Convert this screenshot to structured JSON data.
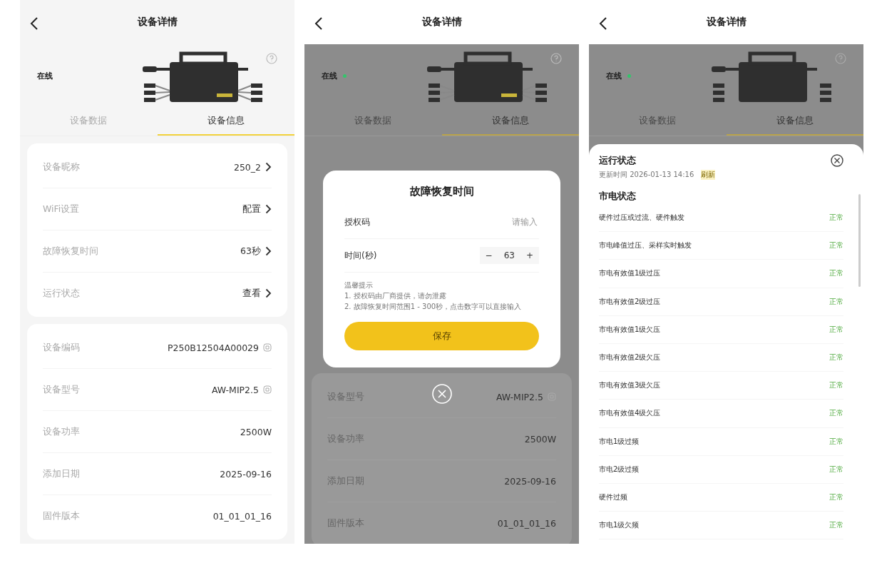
{
  "screens": [
    {
      "title": "设备详情",
      "status": "在线",
      "online_dot": false,
      "dimmed": false,
      "tabs": [
        {
          "label": "设备数据",
          "selected": false
        },
        {
          "label": "设备信息",
          "selected": true
        }
      ],
      "cards": [
        {
          "rows": [
            {
              "label": "设备昵称",
              "value": "250_2",
              "kind": "link"
            },
            {
              "label": "WiFi设置",
              "value": "配置",
              "kind": "link"
            },
            {
              "label": "故障恢复时间",
              "value": "63秒",
              "kind": "link"
            },
            {
              "label": "运行状态",
              "value": "查看",
              "kind": "link"
            }
          ]
        },
        {
          "rows": [
            {
              "label": "设备编码",
              "value": "P250B12504A00029",
              "kind": "copy"
            },
            {
              "label": "设备型号",
              "value": "AW-MIP2.5",
              "kind": "copy"
            },
            {
              "label": "设备功率",
              "value": "2500W",
              "kind": "plain"
            },
            {
              "label": "添加日期",
              "value": "2025-09-16",
              "kind": "plain"
            },
            {
              "label": "固件版本",
              "value": "01_01_01_16",
              "kind": "plain"
            }
          ]
        }
      ]
    },
    {
      "title": "设备详情",
      "status": "在线",
      "online_dot": true,
      "dimmed": true,
      "tabs": [
        {
          "label": "设备数据",
          "selected": false
        },
        {
          "label": "设备信息",
          "selected": true
        }
      ],
      "modal": {
        "title": "故障恢复时间",
        "fields": [
          {
            "label": "授权码",
            "kind": "input",
            "placeholder": "请输入"
          },
          {
            "label": "时间(秒)",
            "kind": "stepper",
            "minus": "−",
            "value": "63",
            "plus": "+"
          }
        ],
        "hint_title": "温馨提示",
        "hints": [
          "1. 授权码由厂商提供，请勿泄露",
          "2. 故障恢复时间范围1 - 300秒，点击数字可以直接输入"
        ],
        "button": "保存"
      },
      "cards": [
        {
          "rows": [
            {
              "label": "设备型号",
              "value": "AW-MIP2.5",
              "kind": "copy"
            },
            {
              "label": "设备功率",
              "value": "2500W",
              "kind": "plain"
            },
            {
              "label": "添加日期",
              "value": "2025-09-16",
              "kind": "plain"
            },
            {
              "label": "固件版本",
              "value": "01_01_01_16",
              "kind": "plain"
            }
          ]
        }
      ]
    },
    {
      "title": "设备详情",
      "status": "在线",
      "online_dot": true,
      "dimmed": true,
      "tabs": [
        {
          "label": "设备数据",
          "selected": false
        },
        {
          "label": "设备信息",
          "selected": true
        }
      ],
      "sheet": {
        "title": "运行状态",
        "updated": "更新时间 2026-01-13 14:16",
        "refresh": "刷新",
        "section": "市电状态",
        "rows": [
          {
            "label": "硬件过压或过流、硬件触发",
            "status": "正常",
            "ok": true
          },
          {
            "label": "市电峰值过压、采样实时触发",
            "status": "正常",
            "ok": true
          },
          {
            "label": "市电有效值1级过压",
            "status": "正常",
            "ok": true
          },
          {
            "label": "市电有效值2级过压",
            "status": "正常",
            "ok": true
          },
          {
            "label": "市电有效值1级欠压",
            "status": "正常",
            "ok": true
          },
          {
            "label": "市电有效值2级欠压",
            "status": "正常",
            "ok": true
          },
          {
            "label": "市电有效值3级欠压",
            "status": "正常",
            "ok": true
          },
          {
            "label": "市电有效值4级欠压",
            "status": "正常",
            "ok": true
          },
          {
            "label": "市电1级过频",
            "status": "正常",
            "ok": true
          },
          {
            "label": "市电2级过频",
            "status": "正常",
            "ok": true
          },
          {
            "label": "硬件过频",
            "status": "正常",
            "ok": true
          },
          {
            "label": "市电1级欠频",
            "status": "正常",
            "ok": true
          }
        ]
      }
    }
  ]
}
